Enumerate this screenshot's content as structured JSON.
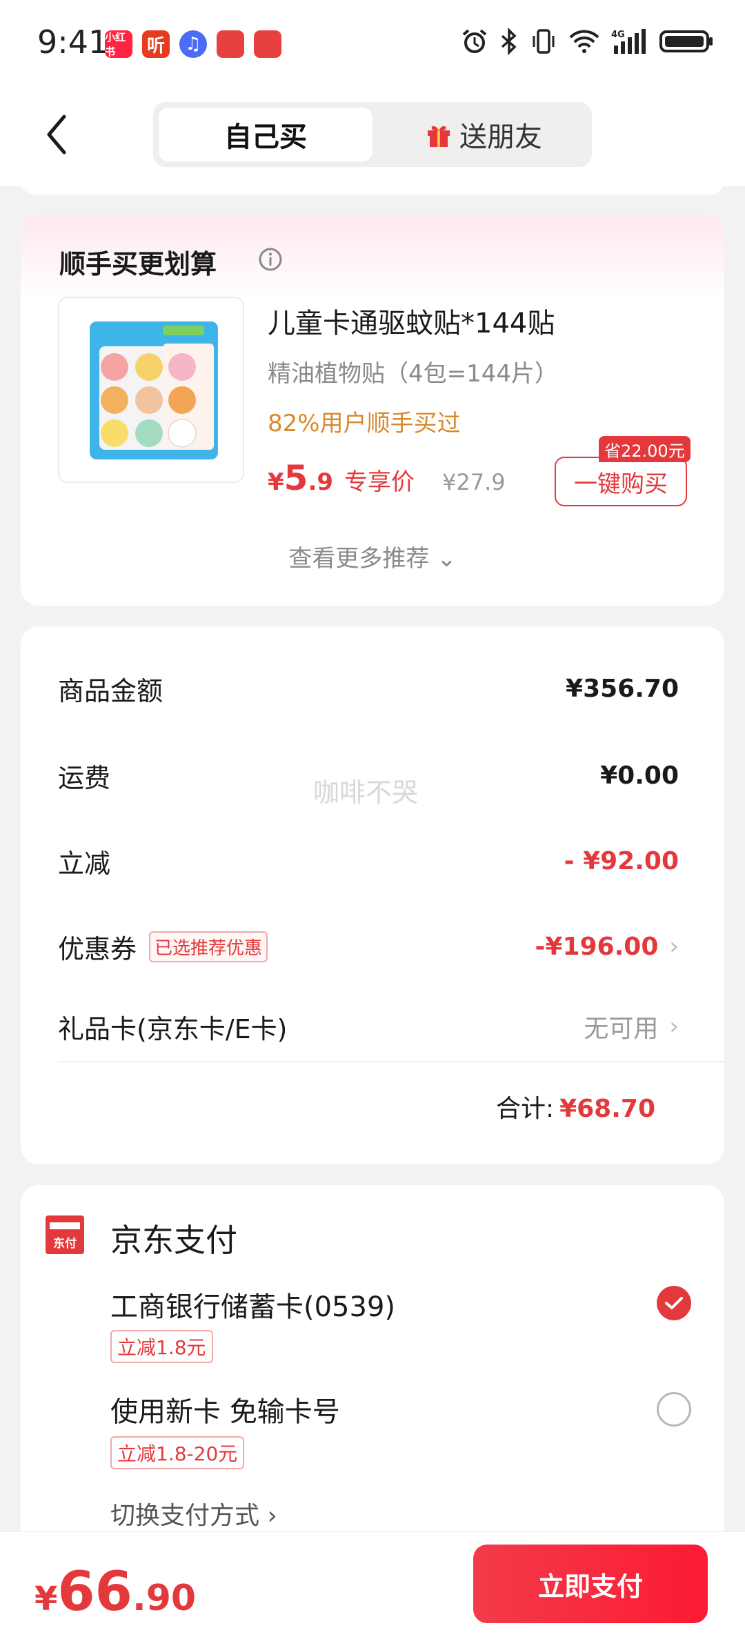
{
  "status": {
    "time": "9:41",
    "apps": [
      {
        "name": "xiaohongshu",
        "text": "小红书",
        "color": "#ff2442"
      },
      {
        "name": "ting",
        "text": "听",
        "color": "#e63b1f"
      },
      {
        "name": "music",
        "text": "♫",
        "color": "#4a6cf7"
      },
      {
        "name": "app4",
        "text": "",
        "color": "#e8403d"
      },
      {
        "name": "app5",
        "text": "",
        "color": "#e8403d"
      }
    ]
  },
  "nav": {
    "self_buy": "自己买",
    "gift_friend": "送朋友"
  },
  "rec": {
    "title": "顺手买更划算",
    "product_name": "儿童卡通驱蚊贴*144贴",
    "product_spec": "精油植物贴（4包=144片）",
    "product_stat": "82%用户顺手买过",
    "price_symbol": "¥",
    "price_int": "5",
    "price_dec": ".9",
    "price_tag": "专享价",
    "price_orig": "¥27.9",
    "save_badge": "省22.00元",
    "buy_label": "一键购买",
    "more": "查看更多推荐 ⌄"
  },
  "summary": {
    "rows": [
      {
        "label": "商品金额",
        "value": "¥356.70"
      },
      {
        "label": "运费",
        "value": "¥0.00"
      },
      {
        "label": "立减",
        "value": "- ¥92.00"
      },
      {
        "label": "优惠券",
        "tag": "已选推荐优惠",
        "value": "-¥196.00"
      },
      {
        "label": "礼品卡(京东卡/E卡)",
        "value": "无可用"
      }
    ],
    "watermark": "咖啡不哭",
    "total_label": "合计:",
    "total_value": "¥68.70"
  },
  "payment": {
    "title": "京东支付",
    "options": [
      {
        "label": "工商银行储蓄卡(0539)",
        "tag": "立减1.8元",
        "selected": true
      },
      {
        "label": "使用新卡 免输卡号",
        "tag": "立减1.8-20元",
        "selected": false
      }
    ],
    "switch": "切换支付方式 ›"
  },
  "bottom": {
    "symbol": "¥",
    "int": "66",
    "dec": ".90",
    "pay_label": "立即支付"
  },
  "colors": {
    "accent": "#e4393c",
    "stat": "#d9892c"
  }
}
